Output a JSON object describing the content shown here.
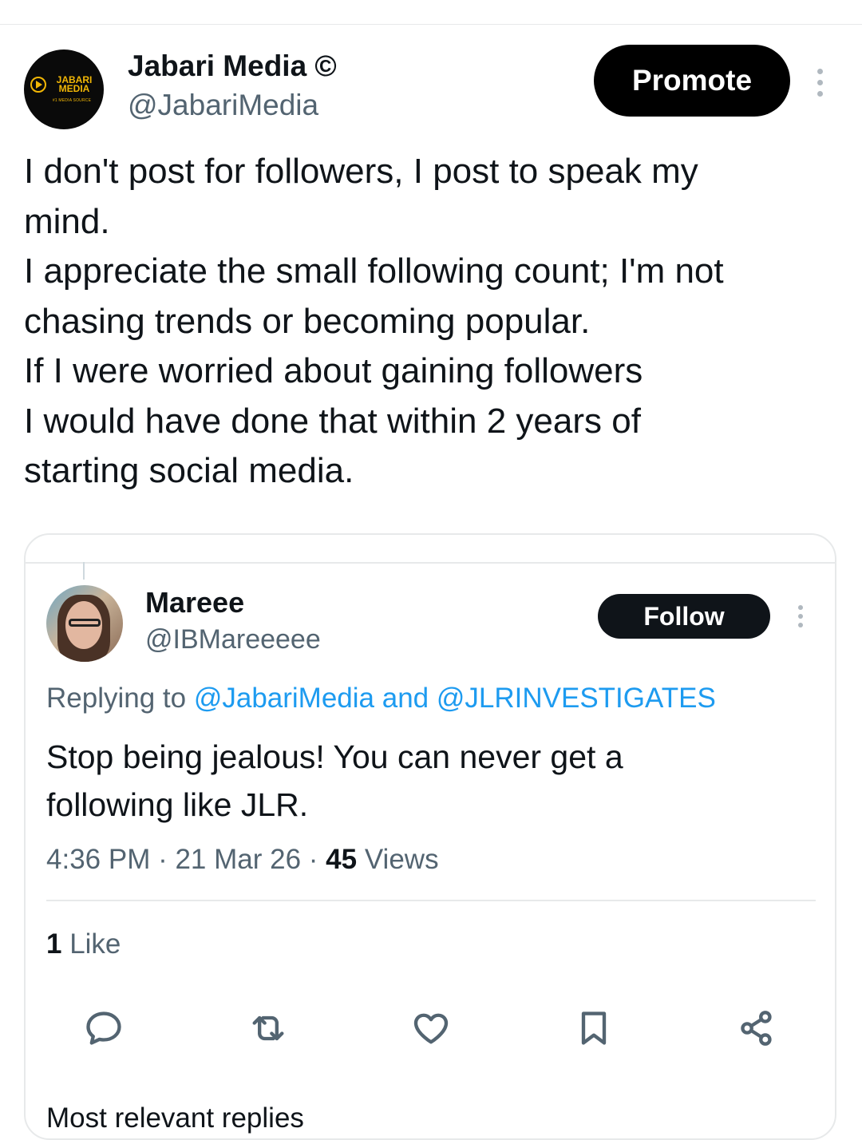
{
  "author": {
    "name": "Jabari Media ©",
    "handle": "@JabariMedia",
    "avatar_logo": {
      "line1": "JABARI",
      "line2": "MEDIA",
      "tagline": "#1 MEDIA SOURCE"
    }
  },
  "header": {
    "promote_label": "Promote",
    "more_icon": "more-vertical-icon"
  },
  "tweet": {
    "text_lines": [
      "I don't post for followers, I post to speak my",
      "mind.",
      "I appreciate the small following count; I'm not",
      "chasing trends or becoming popular.",
      "If I were worried about gaining followers",
      "I would have done that within 2 years of",
      "starting social media."
    ]
  },
  "quoted": {
    "name": "Mareee",
    "handle": "@IBMareeeee",
    "follow_label": "Follow",
    "replying_prefix": "Replying to ",
    "replying_user1": "@JabariMedia",
    "replying_and": " and ",
    "replying_user2": "@JLRINVESTIGATES",
    "text_lines": [
      "Stop being jealous! You can never get a",
      "following like JLR."
    ],
    "time": "4:36 PM",
    "date": "21 Mar 26",
    "separator": " · ",
    "views_count": "45",
    "views_label": " Views",
    "likes_count": "1",
    "likes_label": " Like",
    "actions": [
      "reply-icon",
      "retweet-icon",
      "like-icon",
      "bookmark-icon",
      "share-icon"
    ],
    "cutoff_text": "Most relevant replies"
  },
  "colors": {
    "link": "#1d9bf0",
    "secondary_text": "#536471",
    "logo_gold": "#f2b705"
  }
}
